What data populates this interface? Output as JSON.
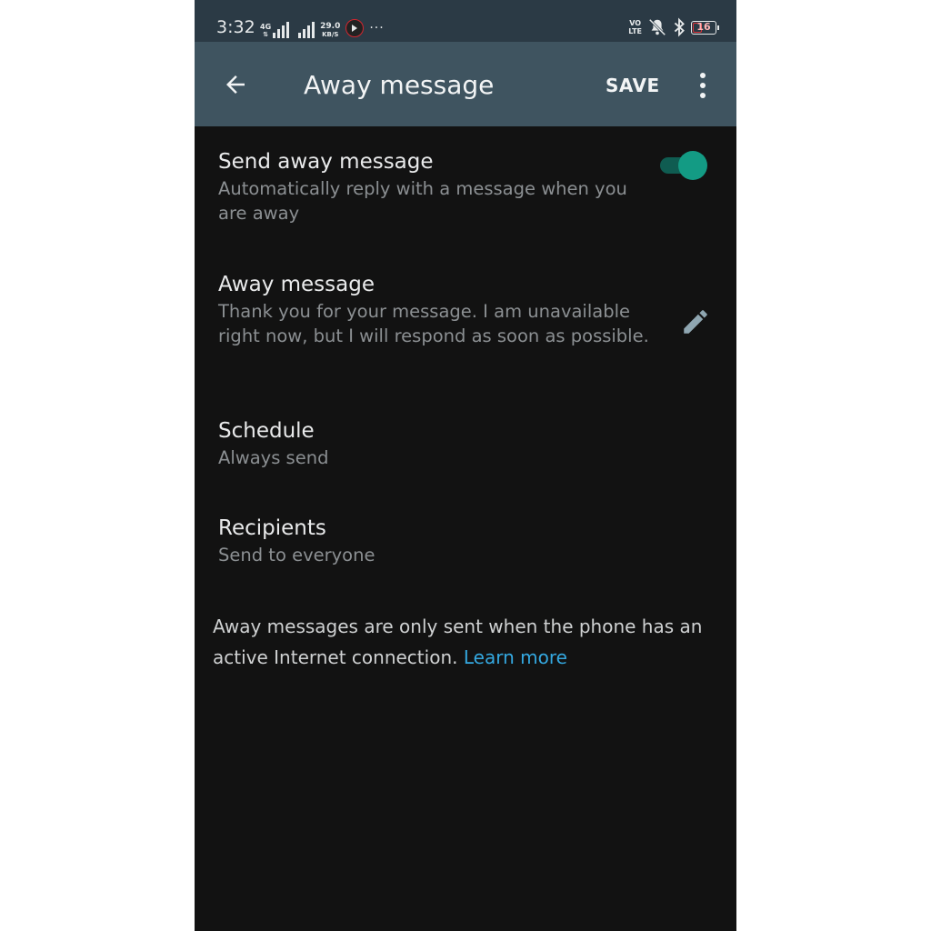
{
  "status_bar": {
    "time": "3:32",
    "network_type": "4G",
    "speed_value": "29.0",
    "speed_unit": "KB/S",
    "overflow": "···",
    "volte_top": "VO",
    "volte_bottom": "LTE",
    "battery_level": "16"
  },
  "appbar": {
    "title": "Away message",
    "save_label": "SAVE"
  },
  "settings": {
    "send_away": {
      "title": "Send away message",
      "subtitle": "Automatically reply with a message when you are away",
      "enabled": true
    },
    "away_message": {
      "title": "Away message",
      "value": "Thank you for your message. I am unavailable right now, but I will respond as soon as possible."
    },
    "schedule": {
      "title": "Schedule",
      "value": "Always send"
    },
    "recipients": {
      "title": "Recipients",
      "value": "Send to everyone"
    }
  },
  "footer": {
    "note": "Away messages are only sent when the phone has an active Internet connection.",
    "link": "Learn more"
  },
  "colors": {
    "appbar": "#3f5460",
    "statusbar": "#2b3a45",
    "background": "#121212",
    "accent": "#139b84",
    "link": "#34a8e0"
  }
}
